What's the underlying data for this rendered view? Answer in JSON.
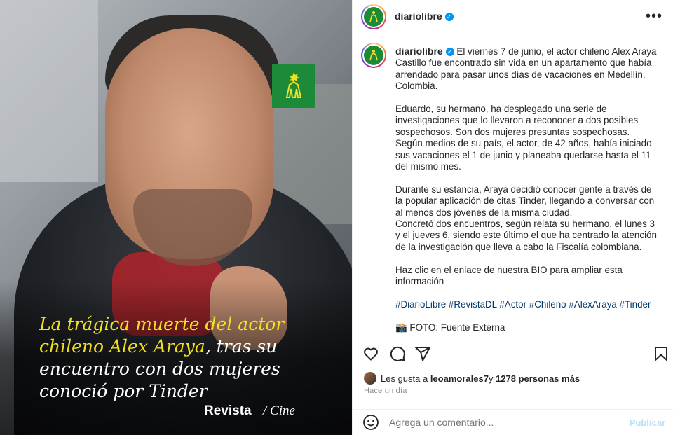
{
  "post_image": {
    "headline_highlight": "La trágica muerte del actor chileno Alex Araya",
    "headline_rest": ", tras su encuentro con dos mujeres conoció por Tinder",
    "brand": "Revista",
    "section": "/ Cine"
  },
  "header": {
    "username": "diariolibre",
    "verified_icon": "verified-badge-icon",
    "more_icon": "more-options-icon"
  },
  "caption": {
    "username": "diariolibre",
    "paragraphs": [
      "El viernes 7 de junio, el actor chileno Alex Araya Castillo fue encontrado sin vida en un apartamento que había arrendado para pasar unos días de vacaciones en Medellín, Colombia.",
      "Eduardo, su hermano, ha desplegado una serie de investigaciones que lo llevaron a reconocer a dos posibles sospechosos. Son dos mujeres presuntas sospechosas.\nSegún medios de su país, el actor, de 42 años, había iniciado sus vacaciones el 1 de junio y planeaba quedarse hasta el 11 del mismo mes.",
      "Durante su estancia, Araya decidió conocer gente a través de la popular aplicación de citas Tinder, llegando a conversar con al menos dos jóvenes de la misma ciudad.\nConcretó dos encuentros, según relata su hermano, el lunes 3 y el jueves 6, siendo este último el que ha centrado la atención de la investigación que lleva a cabo la Fiscalía colombiana.",
      "Haz clic en el enlace de nuestra BIO para ampliar esta información"
    ],
    "hashtags": "#DiarioLibre #RevistaDL #Actor #Chileno #AlexAraya #Tinder",
    "photo_credit": "📸 FOTO: Fuente Externa"
  },
  "actions": {
    "like_icon": "heart-icon",
    "comment_icon": "comment-icon",
    "share_icon": "send-icon",
    "save_icon": "bookmark-icon"
  },
  "likes": {
    "prefix": "Les gusta a ",
    "user": "leoamorales7",
    "middle": " y ",
    "count": "1278 personas más"
  },
  "timestamp": "Hace un día",
  "comment_box": {
    "emoji_icon": "emoji-icon",
    "placeholder": "Agrega un comentario...",
    "publish_label": "Publicar"
  },
  "colors": {
    "brand_green": "#1d8a3a",
    "headline_yellow": "#f3e11f",
    "link_blue": "#00376b",
    "verified_blue": "#0095f6"
  }
}
